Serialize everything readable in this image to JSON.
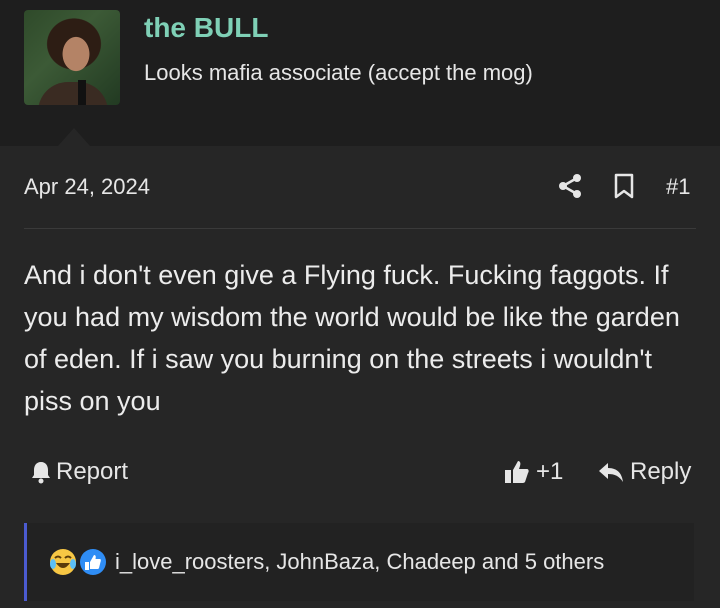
{
  "user": {
    "name": "the BULL",
    "title": "Looks mafia associate (accept the mog)"
  },
  "post": {
    "date": "Apr 24, 2024",
    "number": "#1",
    "text": "And i don't even give a Flying fuck. Fucking faggots. If you had my wisdom the world would be like the garden of eden. If i saw you burning on the streets i wouldn't piss on you"
  },
  "actions": {
    "report": "Report",
    "like_count": "+1",
    "reply": "Reply"
  },
  "reactions": {
    "icons": [
      "laughing-crying-emoji-icon",
      "thumbs-up-reaction-icon"
    ],
    "summary": "i_love_roosters, JohnBaza, Chadeep and 5 others"
  },
  "colors": {
    "username": "#7fd0b6",
    "reaction_bar_accent": "#4b5bd0",
    "background": "#262626"
  }
}
